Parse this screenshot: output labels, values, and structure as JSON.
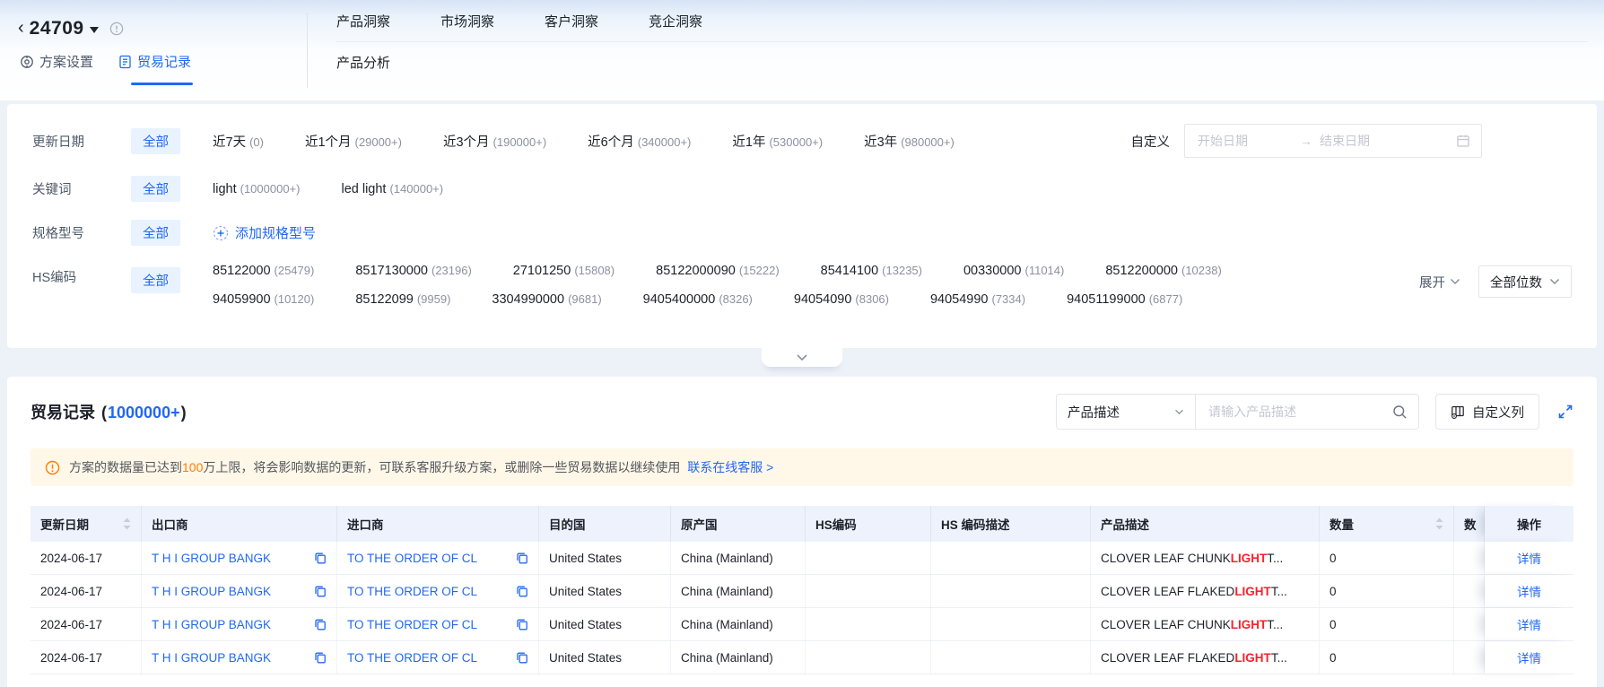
{
  "colors": {
    "primary": "#2268F2",
    "chip_bg": "#E8F3FF",
    "warning_bg": "#FFF7E8",
    "warning_accent": "#FF7D00",
    "highlight_red": "#F5222D",
    "table_header_bg": "#EDF2FC"
  },
  "header": {
    "plan_id": "24709",
    "plan_tabs": [
      {
        "label": "方案设置",
        "active": false
      },
      {
        "label": "贸易记录",
        "active": true
      }
    ],
    "nav": [
      "产品洞察",
      "市场洞察",
      "客户洞察",
      "竞企洞察"
    ],
    "subnav": "产品分析"
  },
  "filters": {
    "update_date": {
      "label": "更新日期",
      "all_label": "全部",
      "options": [
        {
          "name": "近7天",
          "count": "(0)"
        },
        {
          "name": "近1个月",
          "count": "(29000+)"
        },
        {
          "name": "近3个月",
          "count": "(190000+)"
        },
        {
          "name": "近6个月",
          "count": "(340000+)"
        },
        {
          "name": "近1年",
          "count": "(530000+)"
        },
        {
          "name": "近3年",
          "count": "(980000+)"
        }
      ],
      "custom_label": "自定义",
      "start_placeholder": "开始日期",
      "end_placeholder": "结束日期"
    },
    "keyword": {
      "label": "关键词",
      "all_label": "全部",
      "options": [
        {
          "name": "light",
          "count": "(1000000+)"
        },
        {
          "name": "led light",
          "count": "(140000+)"
        }
      ]
    },
    "spec": {
      "label": "规格型号",
      "all_label": "全部",
      "add_label": "添加规格型号"
    },
    "hs_code": {
      "label": "HS编码",
      "all_label": "全部",
      "line1": [
        {
          "name": "85122000",
          "count": "(25479)"
        },
        {
          "name": "8517130000",
          "count": "(23196)"
        },
        {
          "name": "27101250",
          "count": "(15808)"
        },
        {
          "name": "85122000090",
          "count": "(15222)"
        },
        {
          "name": "85414100",
          "count": "(13235)"
        },
        {
          "name": "00330000",
          "count": "(11014)"
        },
        {
          "name": "8512200000",
          "count": "(10238)"
        }
      ],
      "line2": [
        {
          "name": "94059900",
          "count": "(10120)"
        },
        {
          "name": "85122099",
          "count": "(9959)"
        },
        {
          "name": "3304990000",
          "count": "(9681)"
        },
        {
          "name": "9405400000",
          "count": "(8326)"
        },
        {
          "name": "94054090",
          "count": "(8306)"
        },
        {
          "name": "94054990",
          "count": "(7334)"
        },
        {
          "name": "94051199000",
          "count": "(6877)"
        }
      ],
      "expand_label": "展开",
      "digits_label": "全部位数"
    }
  },
  "records": {
    "title": "贸易记录",
    "count": "1000000+",
    "search_type": "产品描述",
    "search_placeholder": "请输入产品描述",
    "customize_label": "自定义列",
    "banner": {
      "text_before": "方案的数据量已达到",
      "highlight": "100",
      "text_after": "万上限，将会影响数据的更新，可联系客服升级方案，或删除一些贸易数据以继续使用",
      "link_label": "联系在线客服 >"
    },
    "table": {
      "columns": [
        "更新日期",
        "出口商",
        "进口商",
        "目的国",
        "原产国",
        "HS编码",
        "HS 编码描述",
        "产品描述",
        "数量",
        "数",
        "操作"
      ],
      "action_label": "详情",
      "rows": [
        {
          "date": "2024-06-17",
          "exporter": "T H I GROUP BANGK",
          "importer": "TO THE ORDER OF CL",
          "destination": "United States",
          "origin": "China (Mainland)",
          "hs_code": "",
          "hs_desc": "",
          "product_before": "CLOVER LEAF CHUNK ",
          "product_highlight": "LIGHT",
          "product_after": " T...",
          "quantity": "0",
          "extra": ""
        },
        {
          "date": "2024-06-17",
          "exporter": "T H I GROUP BANGK",
          "importer": "TO THE ORDER OF CL",
          "destination": "United States",
          "origin": "China (Mainland)",
          "hs_code": "",
          "hs_desc": "",
          "product_before": "CLOVER LEAF FLAKED ",
          "product_highlight": "LIGHT",
          "product_after": " T...",
          "quantity": "0",
          "extra": ""
        },
        {
          "date": "2024-06-17",
          "exporter": "T H I GROUP BANGK",
          "importer": "TO THE ORDER OF CL",
          "destination": "United States",
          "origin": "China (Mainland)",
          "hs_code": "",
          "hs_desc": "",
          "product_before": "CLOVER LEAF CHUNK ",
          "product_highlight": "LIGHT",
          "product_after": " T...",
          "quantity": "0",
          "extra": ""
        },
        {
          "date": "2024-06-17",
          "exporter": "T H I GROUP BANGK",
          "importer": "TO THE ORDER OF CL",
          "destination": "United States",
          "origin": "China (Mainland)",
          "hs_code": "",
          "hs_desc": "",
          "product_before": "CLOVER LEAF FLAKED ",
          "product_highlight": "LIGHT",
          "product_after": " T...",
          "quantity": "0",
          "extra": ""
        }
      ]
    }
  }
}
